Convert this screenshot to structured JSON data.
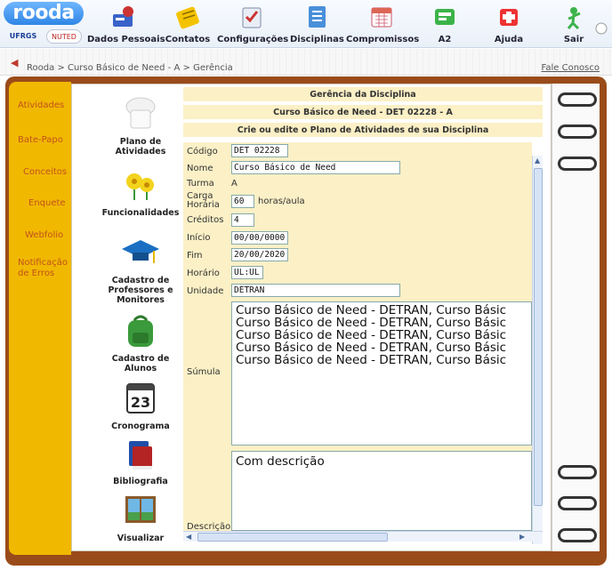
{
  "header": {
    "logo_text": "rooda",
    "sub_logo_left": "UFRGS",
    "sub_logo_right": "NUTED",
    "nav": [
      {
        "label": "Dados Pessoais",
        "icon": "personal-data-icon"
      },
      {
        "label": "Contatos",
        "icon": "contacts-icon"
      },
      {
        "label": "Configurações",
        "icon": "settings-icon"
      },
      {
        "label": "Disciplinas",
        "icon": "courses-icon"
      },
      {
        "label": "Compromissos",
        "icon": "calendar-icon"
      },
      {
        "label": "A2",
        "icon": "a2-icon"
      },
      {
        "label": "Ajuda",
        "icon": "help-icon"
      },
      {
        "label": "Sair",
        "icon": "exit-icon"
      }
    ]
  },
  "breadcrumb": {
    "items": [
      "Rooda",
      "Curso Básico de Need - A",
      "Gerência"
    ],
    "separator": ">",
    "contact_link": "Fale Conosco"
  },
  "tabs": [
    "Atividades",
    "Bate-Papo",
    "Conceitos",
    "Enquete",
    "Webfolio",
    "Notificação de Erros"
  ],
  "menu": [
    {
      "label": "Plano de Atividades",
      "icon": "chef-hat-icon"
    },
    {
      "label": "Funcionalidades",
      "icon": "flowers-icon"
    },
    {
      "label": "Cadastro de Professores e Monitores",
      "icon": "graduation-cap-icon"
    },
    {
      "label": "Cadastro de Alunos",
      "icon": "backpack-icon"
    },
    {
      "label": "Cronograma",
      "icon": "calendar-page-icon"
    },
    {
      "label": "Bibliografia",
      "icon": "books-icon"
    },
    {
      "label": "Visualizar",
      "icon": "window-icon"
    }
  ],
  "content": {
    "header1": "Gerência da Disciplina",
    "header2": "Curso Básico de Need - DET 02228 - A",
    "header3": "Crie ou edite o Plano de Atividades de sua Disciplina",
    "fields": {
      "codigo": {
        "label": "Código",
        "value": "DET 02228"
      },
      "nome": {
        "label": "Nome",
        "value": "Curso Básico de Need"
      },
      "turma": {
        "label": "Turma",
        "value": "A"
      },
      "carga": {
        "label": "Carga Horária",
        "value": "60",
        "unit": "horas/aula"
      },
      "creditos": {
        "label": "Créditos",
        "value": "4"
      },
      "inicio": {
        "label": "Início",
        "value": "00/00/0000"
      },
      "fim": {
        "label": "Fim",
        "value": "20/00/2020"
      },
      "horario": {
        "label": "Horário",
        "value": "UL:UL"
      },
      "unidade": {
        "label": "Unidade",
        "value": "DETRAN"
      },
      "sumula": {
        "label": "Súmula",
        "lines": [
          "Curso Básico de Need - DETRAN, Curso Básic",
          "Curso Básico de Need - DETRAN, Curso Básic",
          "Curso Básico de Need - DETRAN, Curso Básic",
          "Curso Básico de Need - DETRAN, Curso Básic",
          "Curso Básico de Need - DETRAN, Curso Básic"
        ]
      },
      "descricao": {
        "label": "Descrição",
        "value": "Com descrição"
      }
    }
  },
  "colors": {
    "tab_bg": "#f1b800",
    "binder": "#9a4b1a",
    "row_bg": "#fbf0c6",
    "tab_text": "#c1521c"
  }
}
